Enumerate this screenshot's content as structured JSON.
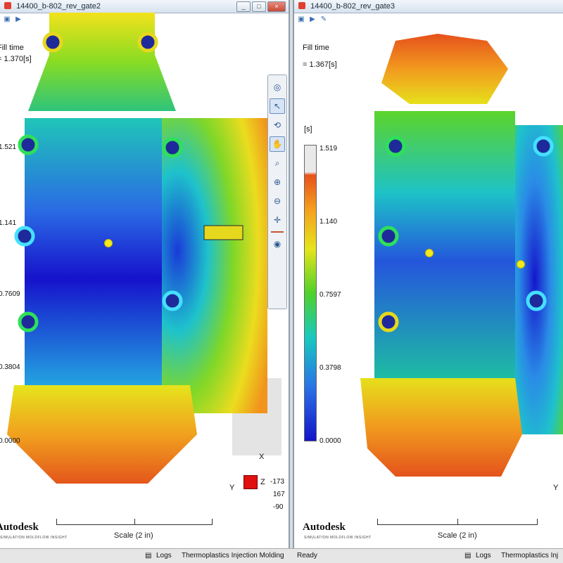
{
  "left_window": {
    "title": "14400_b-802_rev_gate2",
    "result_name": "Fill time",
    "result_value": "= 1.370[s]",
    "unit": "[s]",
    "ticks": [
      "1.521",
      "1.141",
      "0.7609",
      "0.3804",
      "0.0000"
    ],
    "scale_label": "Scale (2 in)",
    "brand": "Autodesk",
    "brand_sub": "SIMULATION MOLDFLOW INSIGHT",
    "axis_x": "X",
    "axis_y": "Y",
    "axis_z": "Z",
    "rotation": [
      "-173",
      "167",
      "-90"
    ],
    "window_buttons": [
      "_",
      "□",
      "×"
    ]
  },
  "right_window": {
    "title": "14400_b-802_rev_gate3",
    "result_name": "Fill time",
    "result_value": "= 1.367[s]",
    "unit": "[s]",
    "ticks": [
      "1.519",
      "1.140",
      "0.7597",
      "0.3798",
      "0.0000"
    ],
    "scale_label": "Scale (2 in)",
    "brand": "Autodesk",
    "brand_sub": "SIMULATION MOLDFLOW INSIGHT",
    "axis_y": "Y"
  },
  "view_toolbar": {
    "icons": [
      "globe-icon",
      "select-arrow-icon",
      "rotate-icon",
      "pan-hand-icon",
      "zoom-icon",
      "zoom-in-icon",
      "zoom-out-icon",
      "center-icon",
      "fit-icon",
      "camera-icon"
    ]
  },
  "status_bar": {
    "logs_left": "Logs",
    "module_left": "Thermoplastics Injection Molding",
    "ready": "Ready",
    "logs_right": "Logs",
    "module_right": "Thermoplastics Inj"
  },
  "colors": {
    "legend_top": "#e8521c",
    "legend_bottom": "#1414c8",
    "gate": "#f3ea1e"
  }
}
